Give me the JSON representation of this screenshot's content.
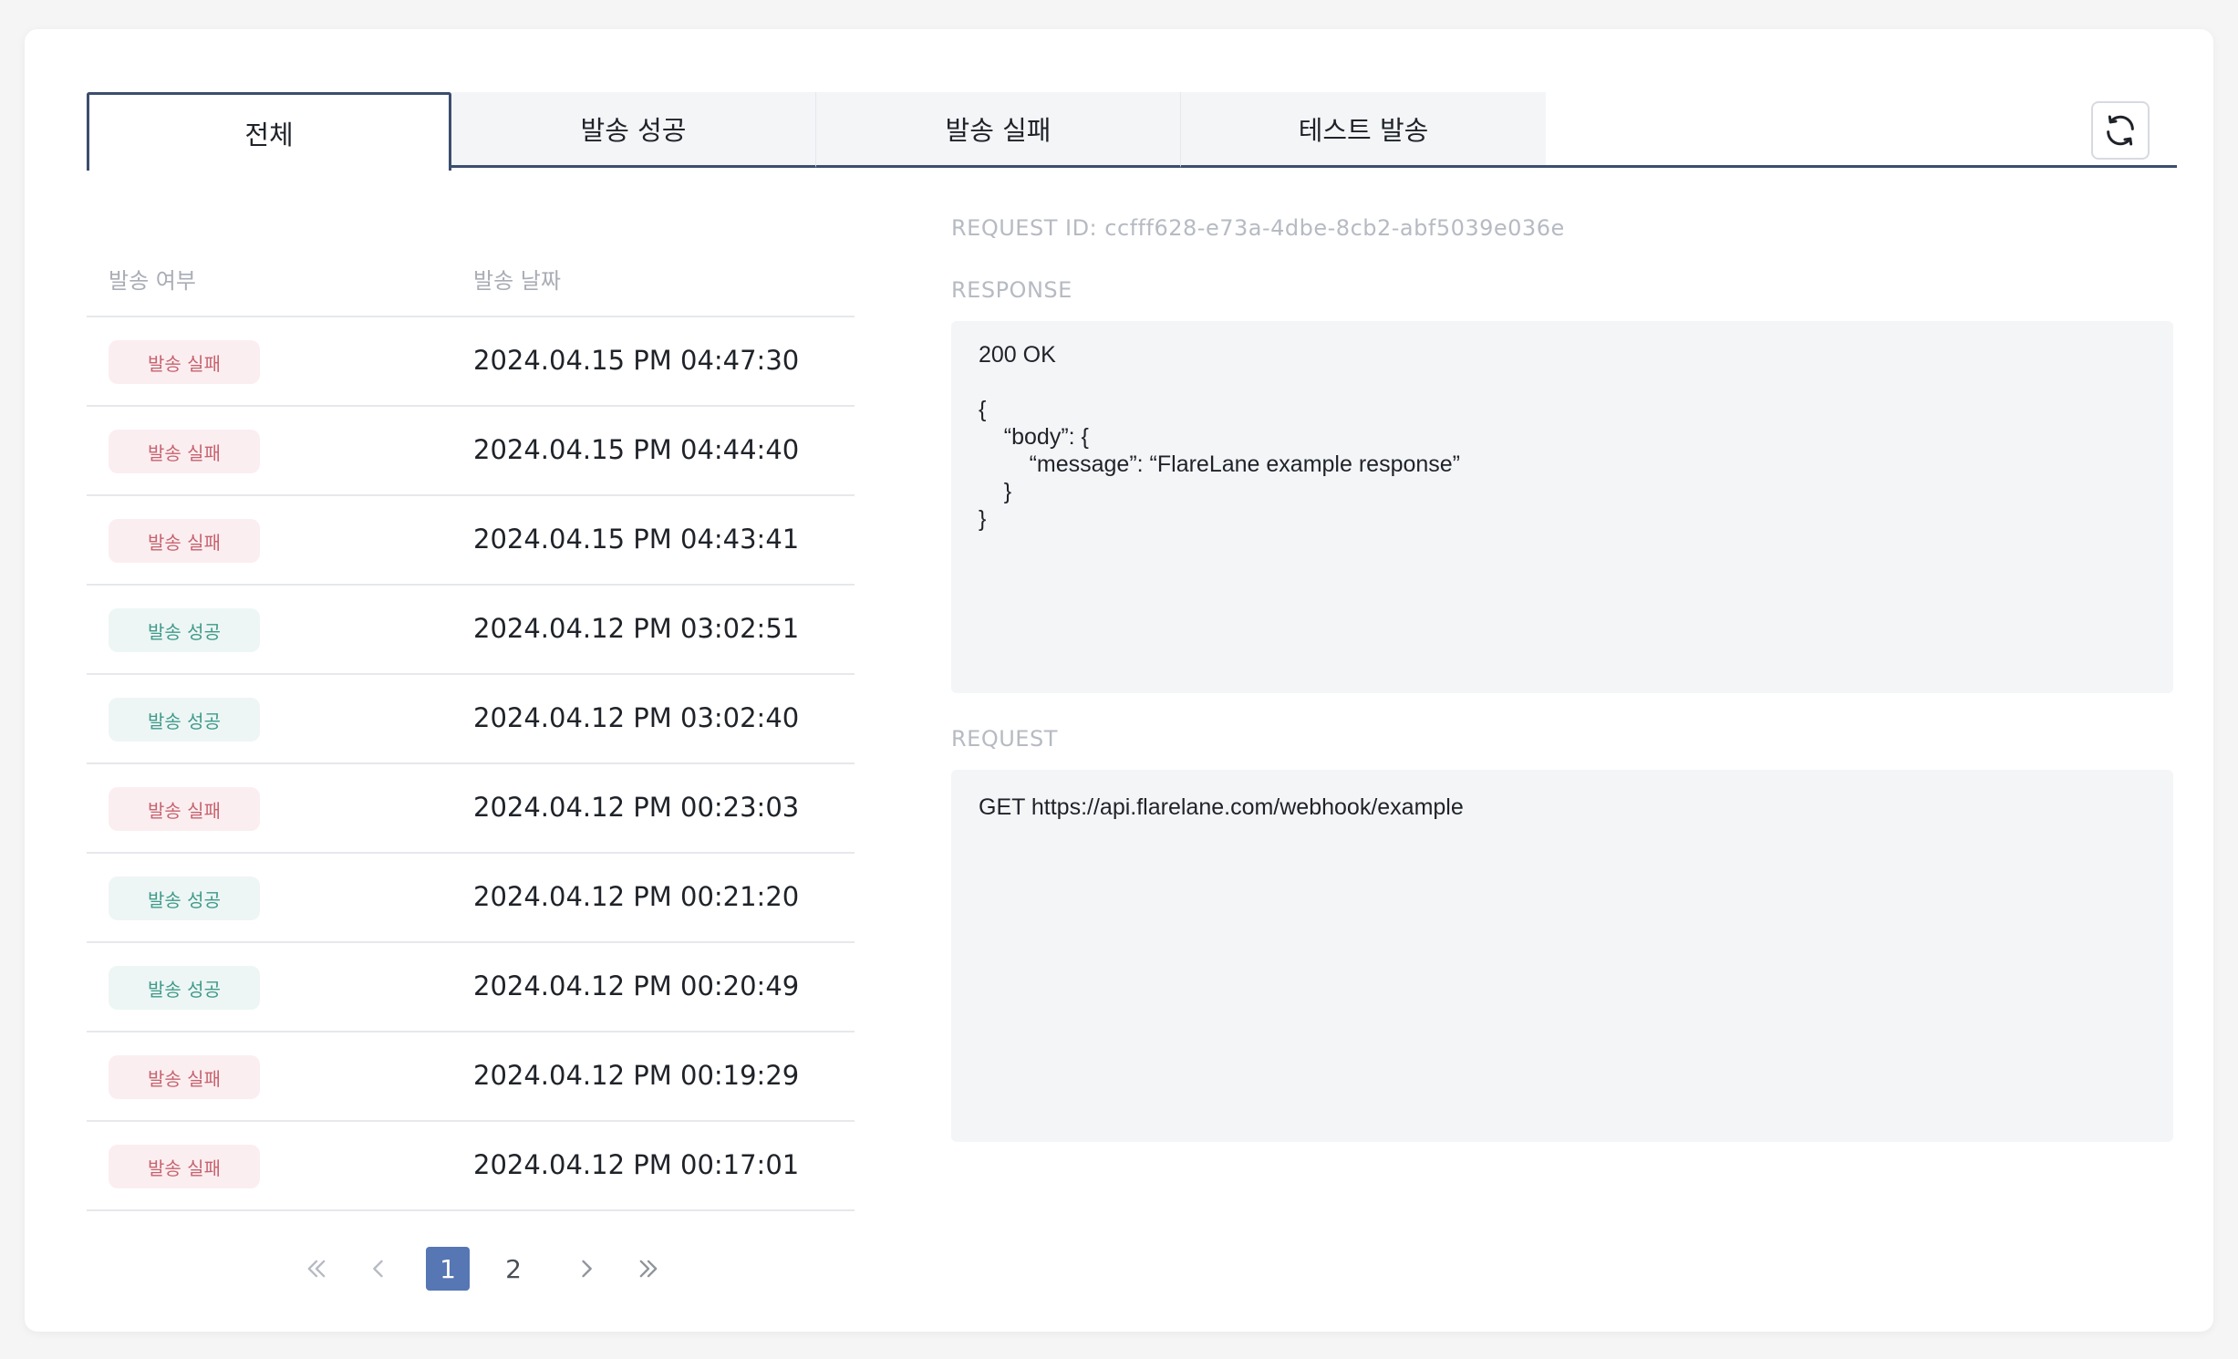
{
  "tabs": [
    {
      "label": "전체",
      "active": true
    },
    {
      "label": "발송 성공",
      "active": false
    },
    {
      "label": "발송 실패",
      "active": false
    },
    {
      "label": "테스트 발송",
      "active": false
    }
  ],
  "toolbar": {
    "refresh_icon": "refresh-icon"
  },
  "table": {
    "headers": {
      "status": "발송 여부",
      "date": "발송 날짜"
    },
    "rows": [
      {
        "status": "발송 실패",
        "state": "fail",
        "date": "2024.04.15 PM 04:47:30"
      },
      {
        "status": "발송 실패",
        "state": "fail",
        "date": "2024.04.15 PM 04:44:40"
      },
      {
        "status": "발송 실패",
        "state": "fail",
        "date": "2024.04.15 PM 04:43:41"
      },
      {
        "status": "발송 성공",
        "state": "ok",
        "date": "2024.04.12 PM 03:02:51"
      },
      {
        "status": "발송 성공",
        "state": "ok",
        "date": "2024.04.12 PM 03:02:40"
      },
      {
        "status": "발송 실패",
        "state": "fail",
        "date": "2024.04.12 PM 00:23:03"
      },
      {
        "status": "발송 성공",
        "state": "ok",
        "date": "2024.04.12 PM 00:21:20"
      },
      {
        "status": "발송 성공",
        "state": "ok",
        "date": "2024.04.12 PM 00:20:49"
      },
      {
        "status": "발송 실패",
        "state": "fail",
        "date": "2024.04.12 PM 00:19:29"
      },
      {
        "status": "발송 실패",
        "state": "fail",
        "date": "2024.04.12 PM 00:17:01"
      }
    ]
  },
  "pagination": {
    "current": "1",
    "next_page": "2"
  },
  "detail": {
    "request_id": "REQUEST ID: ccfff628-e73a-4dbe-8cb2-abf5039e036e",
    "response_label": "RESPONSE",
    "response_body": "200 OK\n\n{\n    “body”: {\n        “message”: “FlareLane example response”\n    }\n}",
    "request_label": "REQUEST",
    "request_body": "GET https://api.flarelane.com/webhook/example"
  },
  "colors": {
    "accent": "#3c4e6e",
    "page_current": "#5676b4",
    "fail_bg": "#fbeef0",
    "fail_text": "#c6636f",
    "ok_bg": "#edf6f5",
    "ok_text": "#3f9a8a"
  }
}
